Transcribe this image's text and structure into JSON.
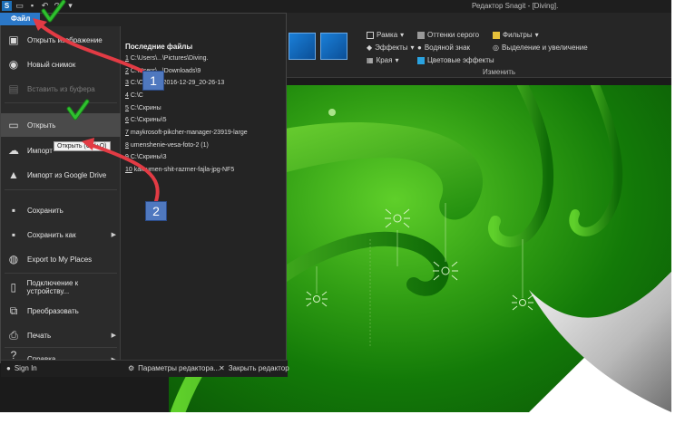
{
  "window": {
    "title": "Редактор Snagit - [Diving].",
    "file_tab": "Файл"
  },
  "ribbon": {
    "frame": "Рамка",
    "effects": "Эффекты",
    "edges": "Края",
    "grayscale": "Оттенки серого",
    "watermark": "Водяной знак",
    "color_effects": "Цветовые эффекты",
    "filters": "Фильтры",
    "spotlight": "Выделение и увеличение",
    "group_label": "Изменить"
  },
  "menu": {
    "items": [
      {
        "label": "Открыть изображение",
        "icon": "image-icon"
      },
      {
        "label": "Новый снимок",
        "icon": "capture-icon"
      },
      {
        "label": "Вставить из буфера",
        "icon": "clipboard-icon"
      },
      {
        "label": "Открыть",
        "icon": "folder-icon"
      },
      {
        "label": "Импорт",
        "icon": "cloud-icon"
      },
      {
        "label": "Импорт из Google Drive",
        "icon": "google-drive-icon"
      },
      {
        "label": "Сохранить",
        "icon": "save-icon"
      },
      {
        "label": "Сохранить как",
        "icon": "save-as-icon"
      },
      {
        "label": "Export to My Places",
        "icon": "export-icon"
      },
      {
        "label": "Подключение к устройству...",
        "icon": "device-icon"
      },
      {
        "label": "Преобразовать",
        "icon": "convert-icon"
      },
      {
        "label": "Печать",
        "icon": "print-icon"
      },
      {
        "label": "Справка",
        "icon": "help-icon"
      }
    ],
    "tooltip": "Открыть (Ctrl+O)",
    "recent_title": "Последние файлы",
    "recent": [
      {
        "num": "1",
        "label": "C:\\Users\\...\\Pictures\\Diving."
      },
      {
        "num": "2",
        "label": "C:\\Users\\...\\Downloads\\9"
      },
      {
        "num": "3",
        "label": "C:\\Скрины\\2016-12-29_20-26-13"
      },
      {
        "num": "4",
        "label": "C:\\С"
      },
      {
        "num": "5",
        "label": "C:\\Скрины"
      },
      {
        "num": "6",
        "label": "C:\\Скрины\\5"
      },
      {
        "num": "7",
        "label": "maykrosoft-pikcher-manager-23919-large"
      },
      {
        "num": "8",
        "label": "umenshenie-vesa-foto-2 (1)"
      },
      {
        "num": "9",
        "label": "C:\\Скрины\\3"
      },
      {
        "num": "10",
        "label": "kak-umen-shit-razmer-fajla-jpg-NF5"
      }
    ],
    "sign_in": "Sign In",
    "editor_settings": "Параметры редактора...",
    "close_editor": "Закрыть редактор"
  },
  "annotations": {
    "callout_1": "1",
    "callout_2": "2",
    "arrow_color": "#e23b44",
    "check_color": "#2fc02f"
  }
}
